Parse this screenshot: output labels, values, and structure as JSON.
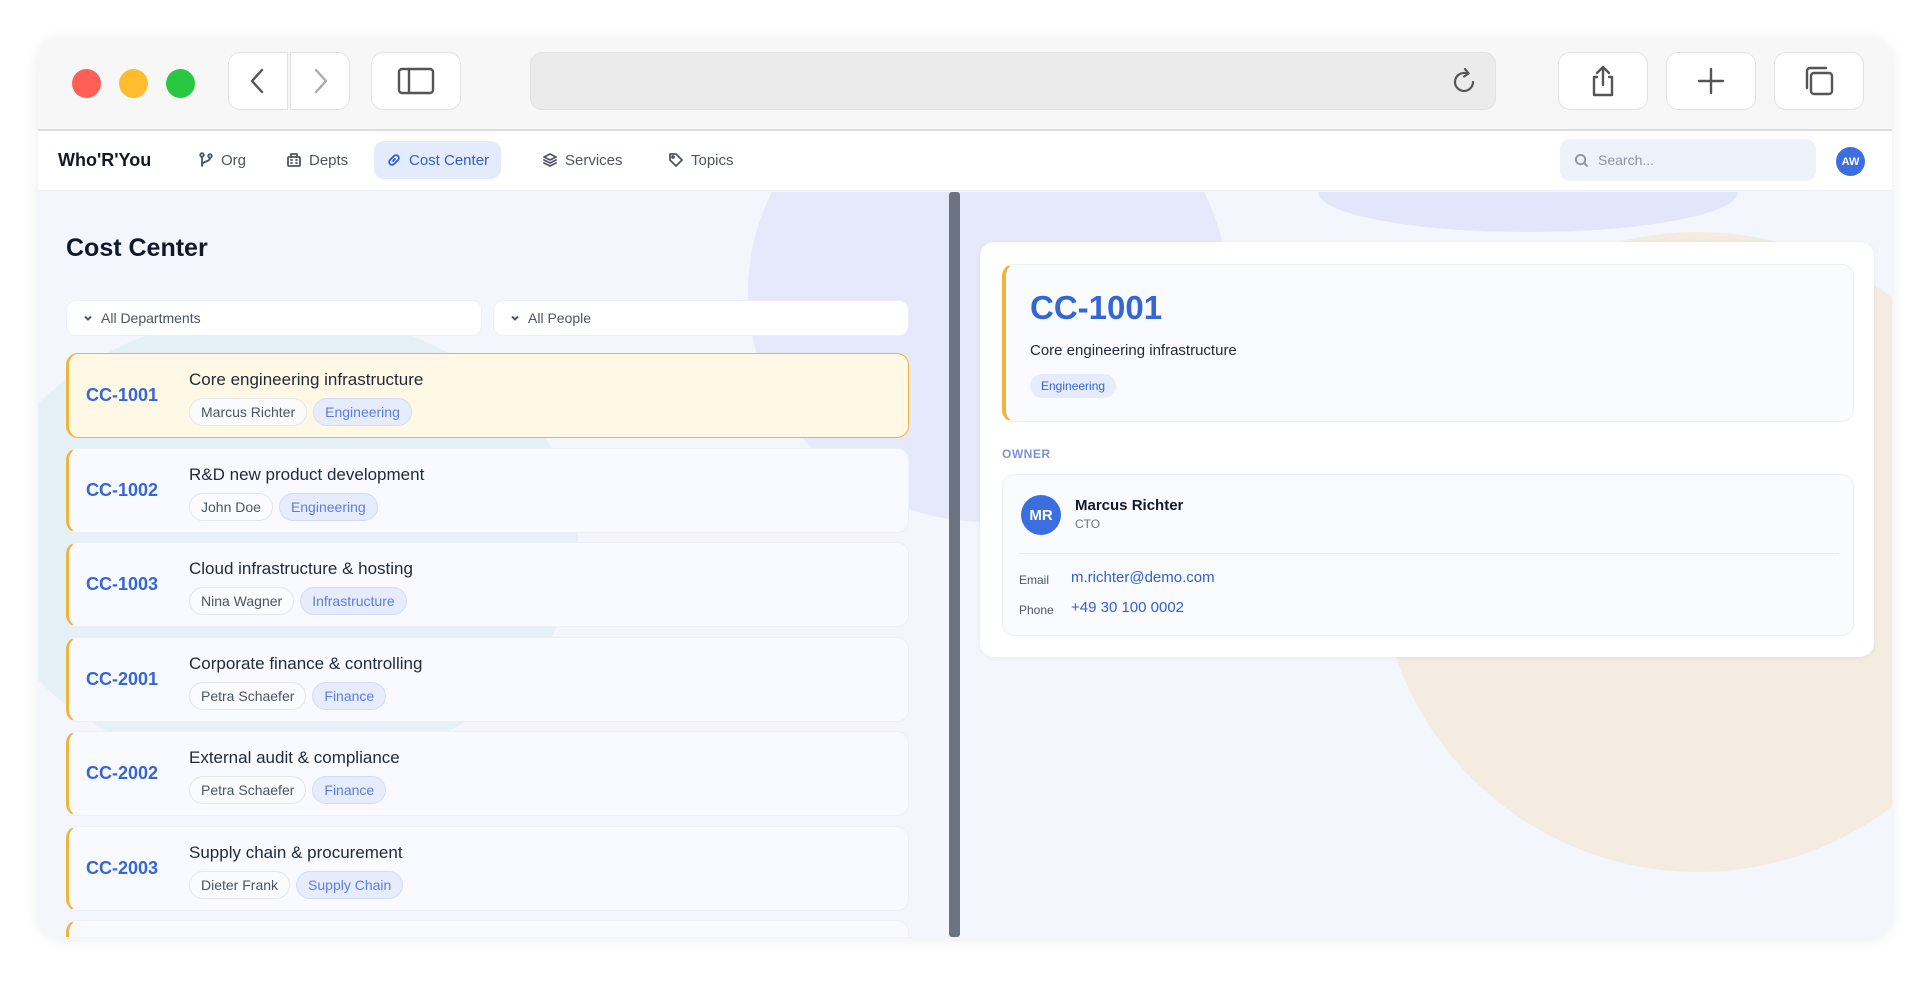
{
  "browser": {
    "url": "",
    "icons": {
      "back": "chevron-left-icon",
      "forward": "chevron-right-icon",
      "sidebar": "sidebar-icon",
      "reload": "reload-icon",
      "share": "share-icon",
      "new_tab": "plus-icon",
      "tabs": "tabs-icon"
    }
  },
  "app": {
    "brand": "Who'R'You",
    "nav": [
      {
        "label": "Org",
        "icon": "git-branch-icon",
        "active": false
      },
      {
        "label": "Depts",
        "icon": "building-icon",
        "active": false
      },
      {
        "label": "Cost Center",
        "icon": "link-icon",
        "active": true
      },
      {
        "label": "Services",
        "icon": "layers-icon",
        "active": false
      },
      {
        "label": "Topics",
        "icon": "tag-icon",
        "active": false
      }
    ],
    "search_placeholder": "Search...",
    "user_initials": "AW",
    "accent": "#3466d6",
    "highlight": "#f0b43a"
  },
  "list": {
    "title": "Cost Center",
    "filters": {
      "departments": "All Departments",
      "people": "All People"
    },
    "items": [
      {
        "code": "CC-1001",
        "description": "Core engineering infrastructure",
        "owner": "Marcus Richter",
        "department": "Engineering",
        "selected": true
      },
      {
        "code": "CC-1002",
        "description": "R&D new product development",
        "owner": "John Doe",
        "department": "Engineering",
        "selected": false
      },
      {
        "code": "CC-1003",
        "description": "Cloud infrastructure & hosting",
        "owner": "Nina Wagner",
        "department": "Infrastructure",
        "selected": false
      },
      {
        "code": "CC-2001",
        "description": "Corporate finance & controlling",
        "owner": "Petra Schaefer",
        "department": "Finance",
        "selected": false
      },
      {
        "code": "CC-2002",
        "description": "External audit & compliance",
        "owner": "Petra Schaefer",
        "department": "Finance",
        "selected": false
      },
      {
        "code": "CC-2003",
        "description": "Supply chain & procurement",
        "owner": "Dieter Frank",
        "department": "Supply Chain",
        "selected": false
      }
    ]
  },
  "detail": {
    "code": "CC-1001",
    "description": "Core engineering infrastructure",
    "department": "Engineering",
    "owner_label": "OWNER",
    "owner": {
      "initials": "MR",
      "name": "Marcus Richter",
      "role": "CTO",
      "email_label": "Email",
      "email": "m.richter@demo.com",
      "phone_label": "Phone",
      "phone": "+49 30 100 0002"
    }
  }
}
